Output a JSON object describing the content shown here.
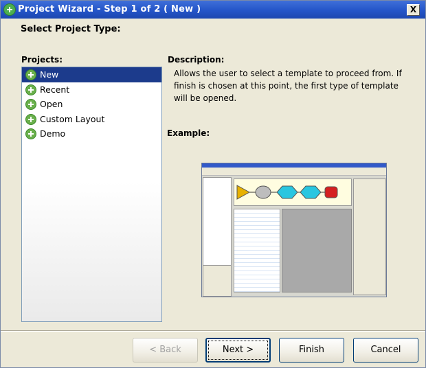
{
  "window": {
    "title": "Project Wizard - Step 1 of 2 ( New )",
    "close_label": "X"
  },
  "heading": "Select Project Type:",
  "projects": {
    "label": "Projects:",
    "selected": "New",
    "items": [
      "New",
      "Recent",
      "Open",
      "Custom Layout",
      "Demo"
    ]
  },
  "description": {
    "label": "Description:",
    "text": "Allows the user to select a template to proceed from. If finish is chosen at this point, the first type of template will be opened."
  },
  "example": {
    "label": "Example:"
  },
  "buttons": {
    "back": "< Back",
    "next": "Next >",
    "finish": "Finish",
    "cancel": "Cancel"
  },
  "colors": {
    "accent": "#1c3b8c",
    "titlebar": "#2455c8",
    "plus_icon": "#6ab04c"
  }
}
